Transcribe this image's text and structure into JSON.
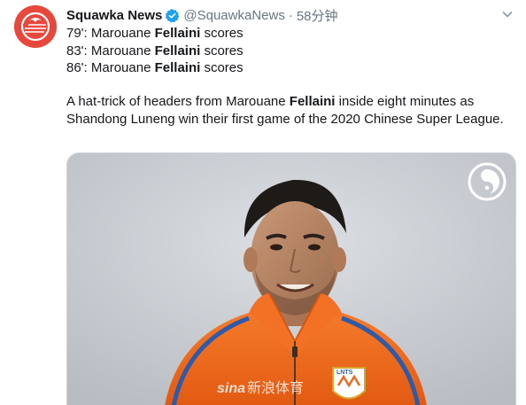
{
  "account": {
    "display_name": "Squawka News",
    "handle": "@SquawkaNews",
    "separator": "·",
    "time": "58分钟",
    "brand_color": "#e8473c",
    "verified_color": "#1da1f2"
  },
  "tweet": {
    "lines": [
      {
        "prefix": "79': Marouane ",
        "bold": "Fellaini",
        "suffix": " scores"
      },
      {
        "prefix": "83': Marouane ",
        "bold": "Fellaini",
        "suffix": " scores"
      },
      {
        "prefix": "86': Marouane ",
        "bold": "Fellaini",
        "suffix": " scores"
      }
    ],
    "paragraph": {
      "before": "A hat-trick of headers from Marouane ",
      "bold": "Fellaini",
      "after": " inside eight minutes as Shandong Luneng win their first game of the 2020 Chinese Super League."
    }
  },
  "media": {
    "watermark_brand": "sina",
    "watermark_cn": "新浪体育",
    "badge_text": "LNTS",
    "jacket_color": "#f26a1b",
    "background_color": "#c9cdd2"
  },
  "icons": {
    "avatar": "squawka-logo-icon",
    "verified": "verified-badge-icon",
    "menu": "chevron-down-icon",
    "corner": "squawka-watermark-icon"
  }
}
